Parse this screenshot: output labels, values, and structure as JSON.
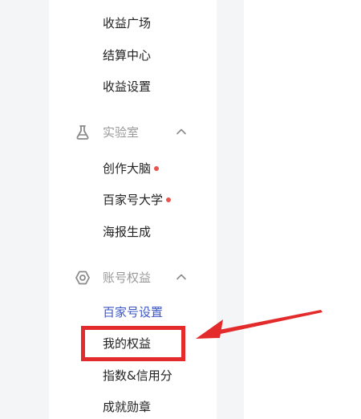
{
  "sidebar": {
    "top_items": [
      {
        "label": "收益广场"
      },
      {
        "label": "结算中心"
      },
      {
        "label": "收益设置"
      }
    ],
    "sections": [
      {
        "title": "实验室",
        "icon": "flask-icon",
        "expanded": true,
        "items": [
          {
            "label": "创作大脑",
            "badge_dot": true
          },
          {
            "label": "百家号大学",
            "badge_dot": true
          },
          {
            "label": "海报生成",
            "badge_dot": false
          }
        ]
      },
      {
        "title": "账号权益",
        "icon": "hexagon-settings-icon",
        "expanded": true,
        "items": [
          {
            "label": "百家号设置",
            "active": true
          },
          {
            "label": "我的权益",
            "highlighted": true
          },
          {
            "label": "指数&信用分"
          },
          {
            "label": "成就勋章"
          }
        ]
      }
    ]
  },
  "colors": {
    "active_text": "#3b56c8",
    "dot": "#e8554e",
    "highlight": "#e32b2b",
    "section_text": "#999999",
    "gutter": "#f4f5f7"
  }
}
